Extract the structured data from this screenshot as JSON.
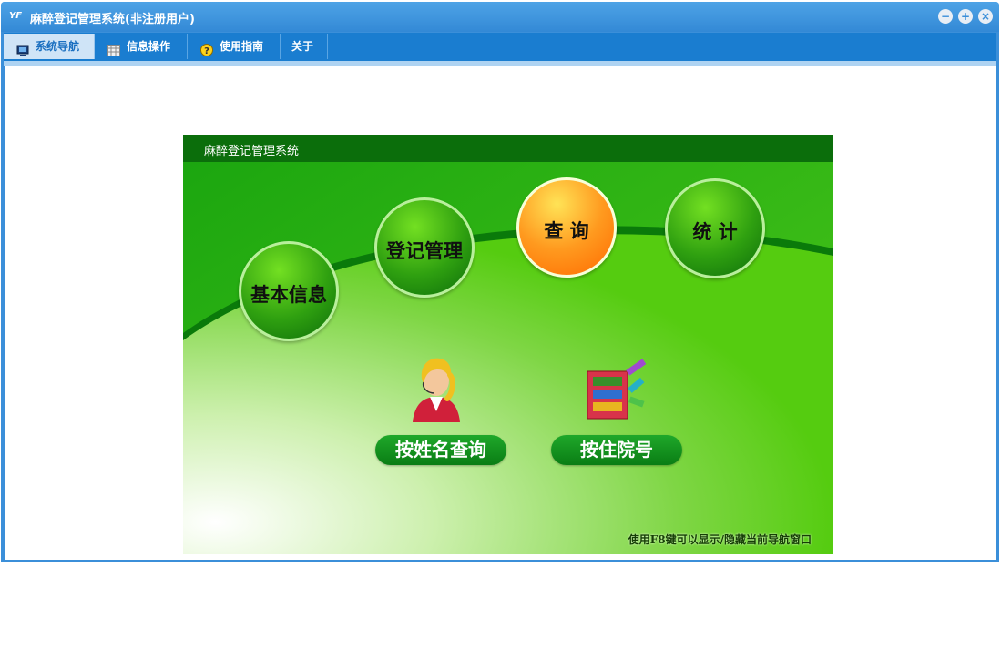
{
  "window": {
    "title": "麻醉登记管理系统(非注册用户)",
    "controls": [
      "−",
      "+",
      "×"
    ]
  },
  "tabs": [
    {
      "label": "系统导航",
      "icon": "monitor-icon",
      "active": true
    },
    {
      "label": "信息操作",
      "icon": "grid-icon",
      "active": false
    },
    {
      "label": "使用指南",
      "icon": "help-icon",
      "active": false
    },
    {
      "label": "关于",
      "icon": "",
      "active": false
    }
  ],
  "nav": {
    "header": "麻醉登记管理系统",
    "circles": [
      {
        "label": "基本信息",
        "active": false
      },
      {
        "label": "登记管理",
        "active": false
      },
      {
        "label": "查 询",
        "active": true
      },
      {
        "label": "统 计",
        "active": false
      }
    ],
    "query_buttons": [
      {
        "label": "按姓名查询",
        "icon": "operator-person-icon"
      },
      {
        "label": "按住院号",
        "icon": "bookshelf-icon"
      }
    ],
    "footnote": "使用F8键可以显示/隐藏当前导航窗口"
  },
  "colors": {
    "titlebar": "#3b8fd9",
    "tabbar": "#1a7dd0",
    "nav_header": "#0b6e0b",
    "nav_green": "#22a317",
    "active_circle": "#ff8a10"
  }
}
